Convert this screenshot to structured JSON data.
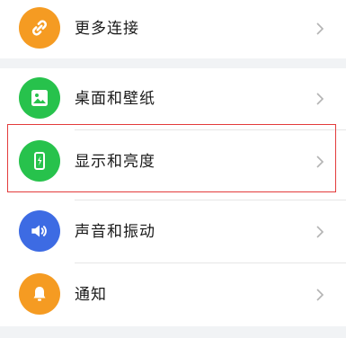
{
  "settings": {
    "items": [
      {
        "label": "更多连接",
        "icon": "link-icon",
        "color": "#f59b22"
      },
      {
        "label": "桌面和壁纸",
        "icon": "wallpaper-image-icon",
        "color": "#27c24c"
      },
      {
        "label": "显示和亮度",
        "icon": "phone-brightness-icon",
        "color": "#27c24c"
      },
      {
        "label": "声音和振动",
        "icon": "speaker-icon",
        "color": "#3d6be3"
      },
      {
        "label": "通知",
        "icon": "bell-icon",
        "color": "#f59b22"
      }
    ]
  },
  "highlight": {
    "color": "#e33b3b",
    "target": "显示和亮度"
  }
}
